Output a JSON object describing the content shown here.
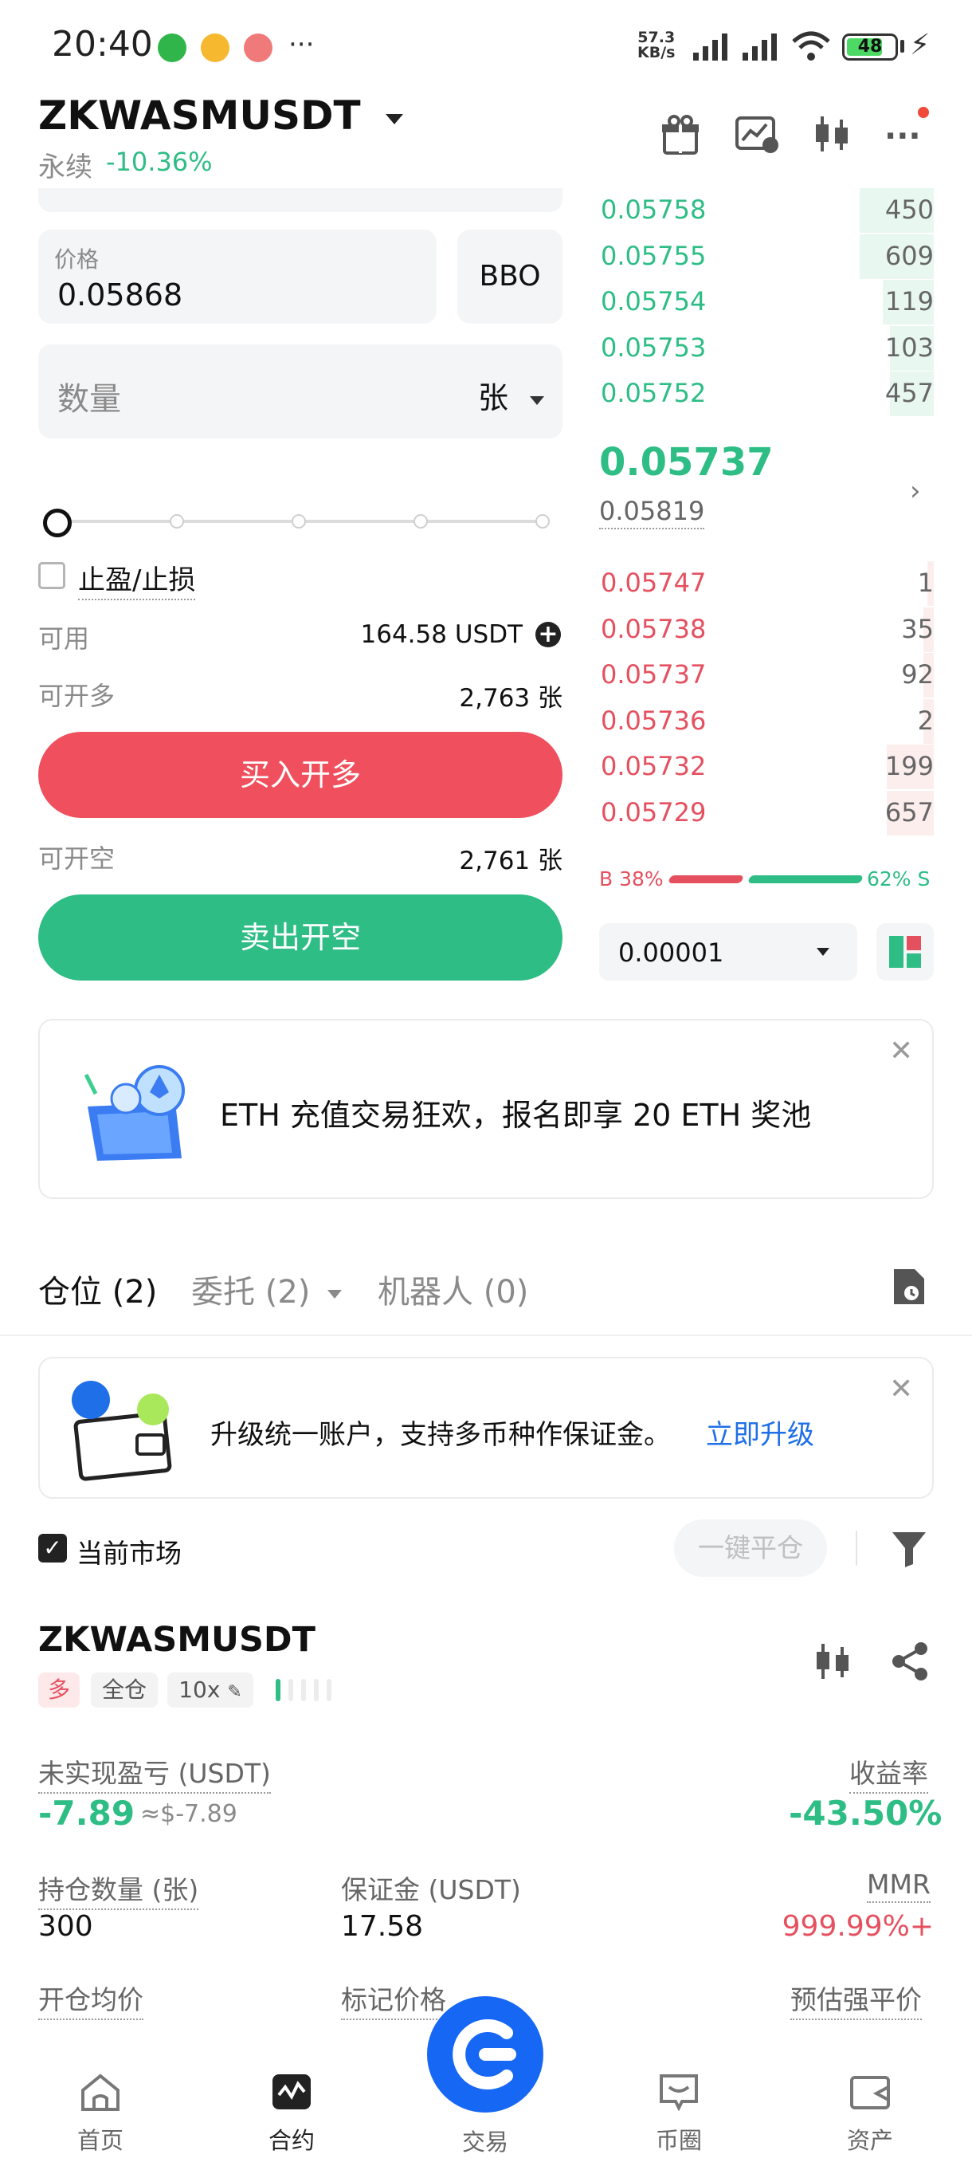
{
  "status_bar": {
    "time": "20:40",
    "net_speed_top": "57.3",
    "net_speed_unit": "KB/s",
    "battery": "48",
    "more": "···"
  },
  "header": {
    "symbol": "ZKWASMUSDT",
    "contract_type": "永续",
    "change": "-10.36%"
  },
  "order_form": {
    "price_label": "价格",
    "price_value": "0.05868",
    "bbo_label": "BBO",
    "qty_placeholder": "数量",
    "qty_unit": "张",
    "tpsl_label": "止盈/止损",
    "available_label": "可用",
    "available_value": "164.58 USDT",
    "can_long_label": "可开多",
    "can_long_value": "2,763 张",
    "buy_label": "买入开多",
    "can_short_label": "可开空",
    "can_short_value": "2,761 张",
    "sell_label": "卖出开空"
  },
  "order_book": {
    "asks": [
      {
        "price": "0.05758",
        "qty": "450",
        "depth": 0.22
      },
      {
        "price": "0.05755",
        "qty": "609",
        "depth": 0.22
      },
      {
        "price": "0.05754",
        "qty": "119",
        "depth": 0.15
      },
      {
        "price": "0.05753",
        "qty": "103",
        "depth": 0.13
      },
      {
        "price": "0.05752",
        "qty": "457",
        "depth": 0.13
      }
    ],
    "last_price": "0.05737",
    "mark_price": "0.05819",
    "bids": [
      {
        "price": "0.05747",
        "qty": "1",
        "depth": 0.02
      },
      {
        "price": "0.05738",
        "qty": "35",
        "depth": 0.03
      },
      {
        "price": "0.05737",
        "qty": "92",
        "depth": 0.03
      },
      {
        "price": "0.05736",
        "qty": "2",
        "depth": 0.03
      },
      {
        "price": "0.05732",
        "qty": "199",
        "depth": 0.14
      },
      {
        "price": "0.05729",
        "qty": "657",
        "depth": 0.14
      }
    ],
    "buy_ratio": "B 38%",
    "sell_ratio": "62% S",
    "precision": "0.00001"
  },
  "eth_banner": {
    "text": "ETH 充值交易狂欢，报名即享 20 ETH 奖池"
  },
  "tabs": {
    "positions": "仓位 (2)",
    "orders": "委托 (2)",
    "bots": "机器人 (0)"
  },
  "upgrade_banner": {
    "text": "升级统一账户，支持多币种作保证金。",
    "link": "立即升级"
  },
  "filter": {
    "current_market": "当前市场",
    "close_all": "一键平仓"
  },
  "position": {
    "symbol": "ZKWASMUSDT",
    "side_tag": "多",
    "margin_tag": "全仓",
    "leverage_tag": "10x",
    "unrealized_label": "未实现盈亏 (USDT)",
    "unrealized_value": "-7.89",
    "unrealized_usd": "≈$-7.89",
    "roe_label": "收益率",
    "roe_value": "-43.50%",
    "size_label": "持仓数量 (张)",
    "size_value": "300",
    "margin_label": "保证金 (USDT)",
    "margin_value": "17.58",
    "mmr_label": "MMR",
    "mmr_value": "999.99%+",
    "entry_label": "开仓均价",
    "mark_label": "标记价格",
    "liq_label": "预估强平价"
  },
  "bottom_nav": {
    "home": "首页",
    "futures": "合约",
    "trade": "交易",
    "community": "币圈",
    "assets": "资产"
  },
  "colors": {
    "green": "#2dbd85",
    "red": "#e5505f",
    "blue": "#1767f5"
  }
}
